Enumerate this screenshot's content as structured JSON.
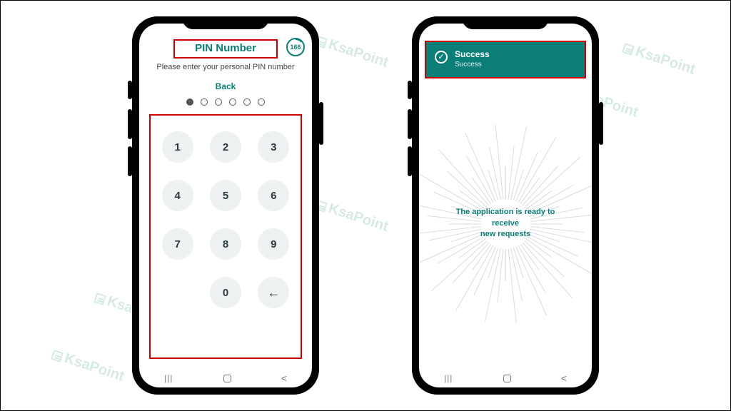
{
  "watermark": "KsaPoint",
  "pin_screen": {
    "title": "PIN Number",
    "timer_value": "166",
    "subtitle": "Please enter your personal PIN number",
    "back_label": "Back",
    "pin_length": 6,
    "pin_entered": 1,
    "keys": [
      "1",
      "2",
      "3",
      "4",
      "5",
      "6",
      "7",
      "8",
      "9",
      "",
      "0",
      "←"
    ]
  },
  "success_screen": {
    "banner_title": "Success",
    "banner_sub": "Success",
    "ready_line1": "The application is ready to receive",
    "ready_line2": "new requests"
  }
}
